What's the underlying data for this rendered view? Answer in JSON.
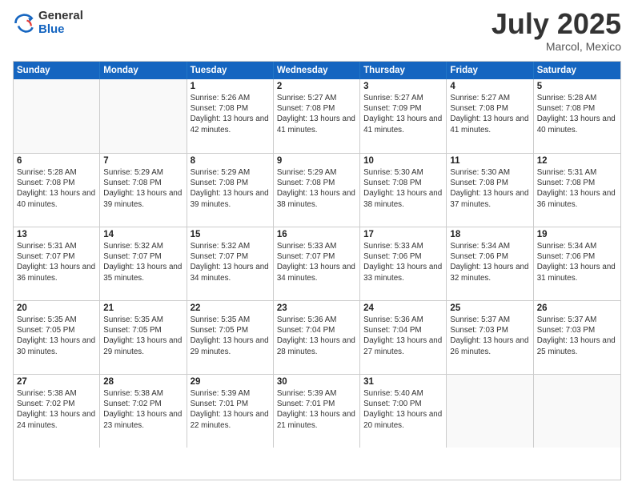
{
  "logo": {
    "general": "General",
    "blue": "Blue"
  },
  "title": {
    "month": "July 2025",
    "location": "Marcol, Mexico"
  },
  "header": {
    "days": [
      "Sunday",
      "Monday",
      "Tuesday",
      "Wednesday",
      "Thursday",
      "Friday",
      "Saturday"
    ]
  },
  "weeks": [
    [
      {
        "day": "",
        "info": ""
      },
      {
        "day": "",
        "info": ""
      },
      {
        "day": "1",
        "info": "Sunrise: 5:26 AM\nSunset: 7:08 PM\nDaylight: 13 hours and 42 minutes."
      },
      {
        "day": "2",
        "info": "Sunrise: 5:27 AM\nSunset: 7:08 PM\nDaylight: 13 hours and 41 minutes."
      },
      {
        "day": "3",
        "info": "Sunrise: 5:27 AM\nSunset: 7:09 PM\nDaylight: 13 hours and 41 minutes."
      },
      {
        "day": "4",
        "info": "Sunrise: 5:27 AM\nSunset: 7:08 PM\nDaylight: 13 hours and 41 minutes."
      },
      {
        "day": "5",
        "info": "Sunrise: 5:28 AM\nSunset: 7:08 PM\nDaylight: 13 hours and 40 minutes."
      }
    ],
    [
      {
        "day": "6",
        "info": "Sunrise: 5:28 AM\nSunset: 7:08 PM\nDaylight: 13 hours and 40 minutes."
      },
      {
        "day": "7",
        "info": "Sunrise: 5:29 AM\nSunset: 7:08 PM\nDaylight: 13 hours and 39 minutes."
      },
      {
        "day": "8",
        "info": "Sunrise: 5:29 AM\nSunset: 7:08 PM\nDaylight: 13 hours and 39 minutes."
      },
      {
        "day": "9",
        "info": "Sunrise: 5:29 AM\nSunset: 7:08 PM\nDaylight: 13 hours and 38 minutes."
      },
      {
        "day": "10",
        "info": "Sunrise: 5:30 AM\nSunset: 7:08 PM\nDaylight: 13 hours and 38 minutes."
      },
      {
        "day": "11",
        "info": "Sunrise: 5:30 AM\nSunset: 7:08 PM\nDaylight: 13 hours and 37 minutes."
      },
      {
        "day": "12",
        "info": "Sunrise: 5:31 AM\nSunset: 7:08 PM\nDaylight: 13 hours and 36 minutes."
      }
    ],
    [
      {
        "day": "13",
        "info": "Sunrise: 5:31 AM\nSunset: 7:07 PM\nDaylight: 13 hours and 36 minutes."
      },
      {
        "day": "14",
        "info": "Sunrise: 5:32 AM\nSunset: 7:07 PM\nDaylight: 13 hours and 35 minutes."
      },
      {
        "day": "15",
        "info": "Sunrise: 5:32 AM\nSunset: 7:07 PM\nDaylight: 13 hours and 34 minutes."
      },
      {
        "day": "16",
        "info": "Sunrise: 5:33 AM\nSunset: 7:07 PM\nDaylight: 13 hours and 34 minutes."
      },
      {
        "day": "17",
        "info": "Sunrise: 5:33 AM\nSunset: 7:06 PM\nDaylight: 13 hours and 33 minutes."
      },
      {
        "day": "18",
        "info": "Sunrise: 5:34 AM\nSunset: 7:06 PM\nDaylight: 13 hours and 32 minutes."
      },
      {
        "day": "19",
        "info": "Sunrise: 5:34 AM\nSunset: 7:06 PM\nDaylight: 13 hours and 31 minutes."
      }
    ],
    [
      {
        "day": "20",
        "info": "Sunrise: 5:35 AM\nSunset: 7:05 PM\nDaylight: 13 hours and 30 minutes."
      },
      {
        "day": "21",
        "info": "Sunrise: 5:35 AM\nSunset: 7:05 PM\nDaylight: 13 hours and 29 minutes."
      },
      {
        "day": "22",
        "info": "Sunrise: 5:35 AM\nSunset: 7:05 PM\nDaylight: 13 hours and 29 minutes."
      },
      {
        "day": "23",
        "info": "Sunrise: 5:36 AM\nSunset: 7:04 PM\nDaylight: 13 hours and 28 minutes."
      },
      {
        "day": "24",
        "info": "Sunrise: 5:36 AM\nSunset: 7:04 PM\nDaylight: 13 hours and 27 minutes."
      },
      {
        "day": "25",
        "info": "Sunrise: 5:37 AM\nSunset: 7:03 PM\nDaylight: 13 hours and 26 minutes."
      },
      {
        "day": "26",
        "info": "Sunrise: 5:37 AM\nSunset: 7:03 PM\nDaylight: 13 hours and 25 minutes."
      }
    ],
    [
      {
        "day": "27",
        "info": "Sunrise: 5:38 AM\nSunset: 7:02 PM\nDaylight: 13 hours and 24 minutes."
      },
      {
        "day": "28",
        "info": "Sunrise: 5:38 AM\nSunset: 7:02 PM\nDaylight: 13 hours and 23 minutes."
      },
      {
        "day": "29",
        "info": "Sunrise: 5:39 AM\nSunset: 7:01 PM\nDaylight: 13 hours and 22 minutes."
      },
      {
        "day": "30",
        "info": "Sunrise: 5:39 AM\nSunset: 7:01 PM\nDaylight: 13 hours and 21 minutes."
      },
      {
        "day": "31",
        "info": "Sunrise: 5:40 AM\nSunset: 7:00 PM\nDaylight: 13 hours and 20 minutes."
      },
      {
        "day": "",
        "info": ""
      },
      {
        "day": "",
        "info": ""
      }
    ]
  ]
}
